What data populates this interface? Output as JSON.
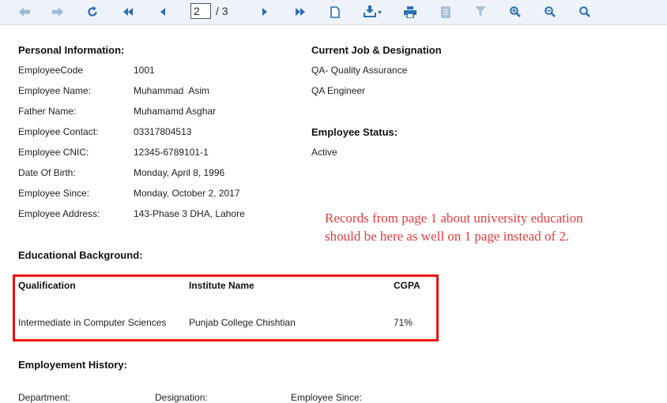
{
  "toolbar": {
    "current_page": "2",
    "page_total": "/ 3",
    "icons": [
      "arrow-back-icon",
      "arrow-forward-icon",
      "refresh-icon",
      "first-page-icon",
      "previous-page-icon",
      "next-page-icon",
      "last-page-icon",
      "document-icon",
      "export-icon",
      "print-icon",
      "page-setup-icon",
      "filter-icon",
      "zoom-in-icon",
      "zoom-out-icon",
      "zoom-icon"
    ]
  },
  "personal": {
    "heading": "Personal Information:",
    "fields": [
      {
        "label": "EmployeeCode",
        "value": "1001"
      },
      {
        "label": "Employee Name:",
        "value": "Muhammad  Asim"
      },
      {
        "label": "Father Name:",
        "value": "Muhamamd Asghar"
      },
      {
        "label": "Employee Contact:",
        "value": "03317804513"
      },
      {
        "label": "Employee CNIC:",
        "value": "12345-6789101-1"
      },
      {
        "label": "Date Of Birth:",
        "value": "Monday, April 8, 1996"
      },
      {
        "label": "Employee Since:",
        "value": "Monday, October 2, 2017"
      },
      {
        "label": "Employee Address:",
        "value": "143-Phase 3 DHA, Lahore"
      }
    ]
  },
  "job": {
    "heading": "Current Job & Designation",
    "department": "QA- Quality Assurance",
    "designation": "QA Engineer",
    "status_heading": "Employee Status:",
    "status": "Active"
  },
  "annotation": {
    "line1": "Records from page 1 about university education",
    "line2": "should be here as well on 1 page instead of 2."
  },
  "education": {
    "heading": "Educational Background:",
    "columns": [
      "Qualification",
      "Institute Name",
      "CGPA"
    ],
    "rows": [
      [
        "Intermediate in Computer Sciences",
        "Punjab College Chishtian",
        "71%"
      ]
    ]
  },
  "employment": {
    "heading": "Employement History:",
    "columns": [
      "Department:",
      "Designation:",
      "Employee Since:"
    ]
  },
  "colors": {
    "accent_blue": "#2b6fb3",
    "annotation_red": "#e23c3c",
    "highlight_red": "#ee1111"
  }
}
